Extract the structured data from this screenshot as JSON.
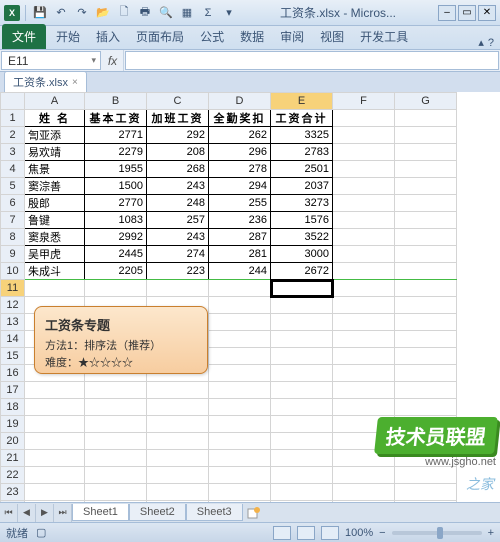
{
  "title": "工资条.xlsx - Micros...",
  "qat_icons": [
    "save-icon",
    "undo-icon",
    "redo-icon",
    "open-icon",
    "new-icon",
    "print-icon",
    "preview-icon",
    "grid-icon",
    "sum-icon",
    "dropdown-icon"
  ],
  "tabs": {
    "file": "文件",
    "items": [
      "开始",
      "插入",
      "页面布局",
      "公式",
      "数据",
      "审阅",
      "视图",
      "开发工具"
    ]
  },
  "ribbon_help": "?",
  "namebox": "E11",
  "fx": "fx",
  "workbook_tab": "工资条.xlsx",
  "columns": [
    "A",
    "B",
    "C",
    "D",
    "E",
    "F",
    "G"
  ],
  "row_count": 24,
  "active_cell": {
    "row": 11,
    "col": "E"
  },
  "headers": [
    "姓  名",
    "基本工资",
    "加班工资",
    "全勤奖扣",
    "工资合计"
  ],
  "rows": [
    {
      "name": "訇亚添",
      "base": 2771,
      "ot": 292,
      "bonus": 262,
      "total": 3325
    },
    {
      "name": "易欢靖",
      "base": 2279,
      "ot": 208,
      "bonus": 296,
      "total": 2783
    },
    {
      "name": "焦景",
      "base": 1955,
      "ot": 268,
      "bonus": 278,
      "total": 2501
    },
    {
      "name": "窦淙善",
      "base": 1500,
      "ot": 243,
      "bonus": 294,
      "total": 2037
    },
    {
      "name": "殷郎",
      "base": 2770,
      "ot": 248,
      "bonus": 255,
      "total": 3273
    },
    {
      "name": "鲁键",
      "base": 1083,
      "ot": 257,
      "bonus": 236,
      "total": 1576
    },
    {
      "name": "窦泉悉",
      "base": 2992,
      "ot": 243,
      "bonus": 287,
      "total": 3522
    },
    {
      "name": "吴甲虎",
      "base": 2445,
      "ot": 274,
      "bonus": 281,
      "total": 3000
    },
    {
      "name": "朱成斗",
      "base": 2205,
      "ot": 223,
      "bonus": 244,
      "total": 2672
    }
  ],
  "callout": {
    "title": "工资条专题",
    "line1": "方法1：排序法（推荐）",
    "line2": "难度：★☆☆☆☆"
  },
  "watermark": {
    "big": "技术员联盟",
    "sub": "www.jsgho.net",
    "side": "之家"
  },
  "sheets": [
    "Sheet1",
    "Sheet2",
    "Sheet3"
  ],
  "active_sheet": 0,
  "status": "就绪",
  "zoom": "100%",
  "zoom_minus": "−",
  "zoom_plus": "+"
}
